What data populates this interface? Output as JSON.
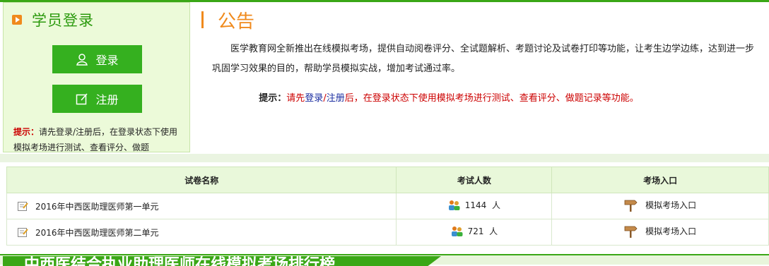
{
  "login": {
    "title": "学员登录",
    "login_button": "登录",
    "register_button": "注册",
    "hint_label": "提示：",
    "hint_text": "请先登录/注册后，在登录状态下使用模拟考场进行测试、查看评分、做题"
  },
  "notice": {
    "title": "公告",
    "body": "医学教育网全新推出在线模拟考场，提供自动阅卷评分、全试题解析、考题讨论及试卷打印等功能，让考生边学边练，达到进一步巩固学习效果的目的，帮助学员模拟实战，增加考试通过率。",
    "tip_label": "提示：",
    "tip_part1": "请先",
    "tip_login": "登录",
    "tip_slash": "/",
    "tip_register": "注册",
    "tip_part2": "后，在登录状态下使用模拟考场进行测试、查看评分、做题记录等功能。"
  },
  "table": {
    "headers": [
      "试卷名称",
      "考试人数",
      "考场入口"
    ],
    "rows": [
      {
        "name": "2016年中西医助理医师第一单元",
        "count": "1144",
        "unit": "人",
        "entry": "模拟考场入口"
      },
      {
        "name": "2016年中西医助理医师第二单元",
        "count": "721",
        "unit": "人",
        "entry": "模拟考场入口"
      }
    ]
  },
  "bottom": {
    "banner_title": "中西医结合执业助理医师在线模拟考场排行榜"
  },
  "colors": {
    "accent_green": "#35b01f",
    "orange": "#f08a1c",
    "red": "#cc0000"
  }
}
